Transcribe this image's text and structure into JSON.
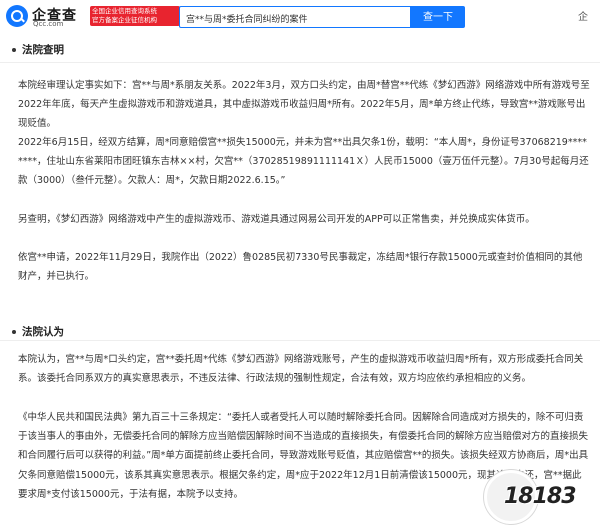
{
  "header": {
    "logo_name": "企查查",
    "logo_url": "Qcc.com",
    "logo_tag_line1": "全国企业信用查询系统",
    "logo_tag_line2": "官方备案企业征信机构",
    "search_value": "宫**与周*委托合同纠纷的案件",
    "search_button": "查一下",
    "right_text": "企"
  },
  "sections": [
    {
      "title": "法院查明",
      "paragraphs": [
        "本院经审理认定事实如下：宫**与周*系朋友关系。2022年3月，双方口头约定，由周*替宫**代练《梦幻西游》网络游戏中所有游戏号至2022年年底，每天产生虚拟游戏币和游戏道具，其中虚拟游戏币收益归周*所有。2022年5月，周*单方终止代练，导致宫**游戏账号出现贬值。",
        "2022年6月15日，经双方结算，周*同意赔偿宫**损失15000元，并未为宫**出具欠条1份，载明：“本人周*，身份证号37068219********，住址山东省莱阳市团旺镇东吉林××村，欠宫**（37028519891111141Ｘ）人民币15000（壹万伍仟元整）。7月30号起每月还款（3000）（叁仟元整）。欠款人：周*，欠款日期2022.6.15。”",
        "另查明，《梦幻西游》网络游戏中产生的虚拟游戏币、游戏道具通过网易公司开发的APP可以正常售卖，并兑换成实体货币。",
        "依宫**申请，2022年11月29日，我院作出（2022）鲁0285民初7330号民事裁定，冻结周*银行存款15000元或查封价值相同的其他财产，并已执行。"
      ]
    },
    {
      "title": "法院认为",
      "paragraphs": [
        "本院认为，宫**与周*口头约定，宫**委托周*代练《梦幻西游》网络游戏账号，产生的虚拟游戏币收益归周*所有，双方形成委托合同关系。该委托合同系双方的真实意思表示，不违反法律、行政法规的强制性规定，合法有效，双方均应依约承担相应的义务。",
        "《中华人民共和国民法典》第九百三十三条规定：“委托人或者受托人可以随时解除委托合同。因解除合同造成对方损失的，除不可归责于该当事人的事由外，无偿委托合同的解除方应当赔偿因解除时间不当造成的直接损失，有偿委托合同的解除方应当赔偿对方的直接损失和合同履行后可以获得的利益。”周*单方面提前终止委托合同，导致游戏账号贬值，其应赔偿宫**的损失。该损失经双方协商后，周*出具欠条同意赔偿15000元，该系其真实意思表示。根据欠条约定，周*应于2022年12月1日前清偿该15000元，现其逾期未还，宫**据此要求周*支付该15000元，于法有据，本院予以支持。"
      ]
    }
  ],
  "watermark": {
    "text": "18183"
  },
  "colors": {
    "brand_blue": "#1277ff",
    "tag_red": "#e8242f",
    "text": "#333333"
  }
}
